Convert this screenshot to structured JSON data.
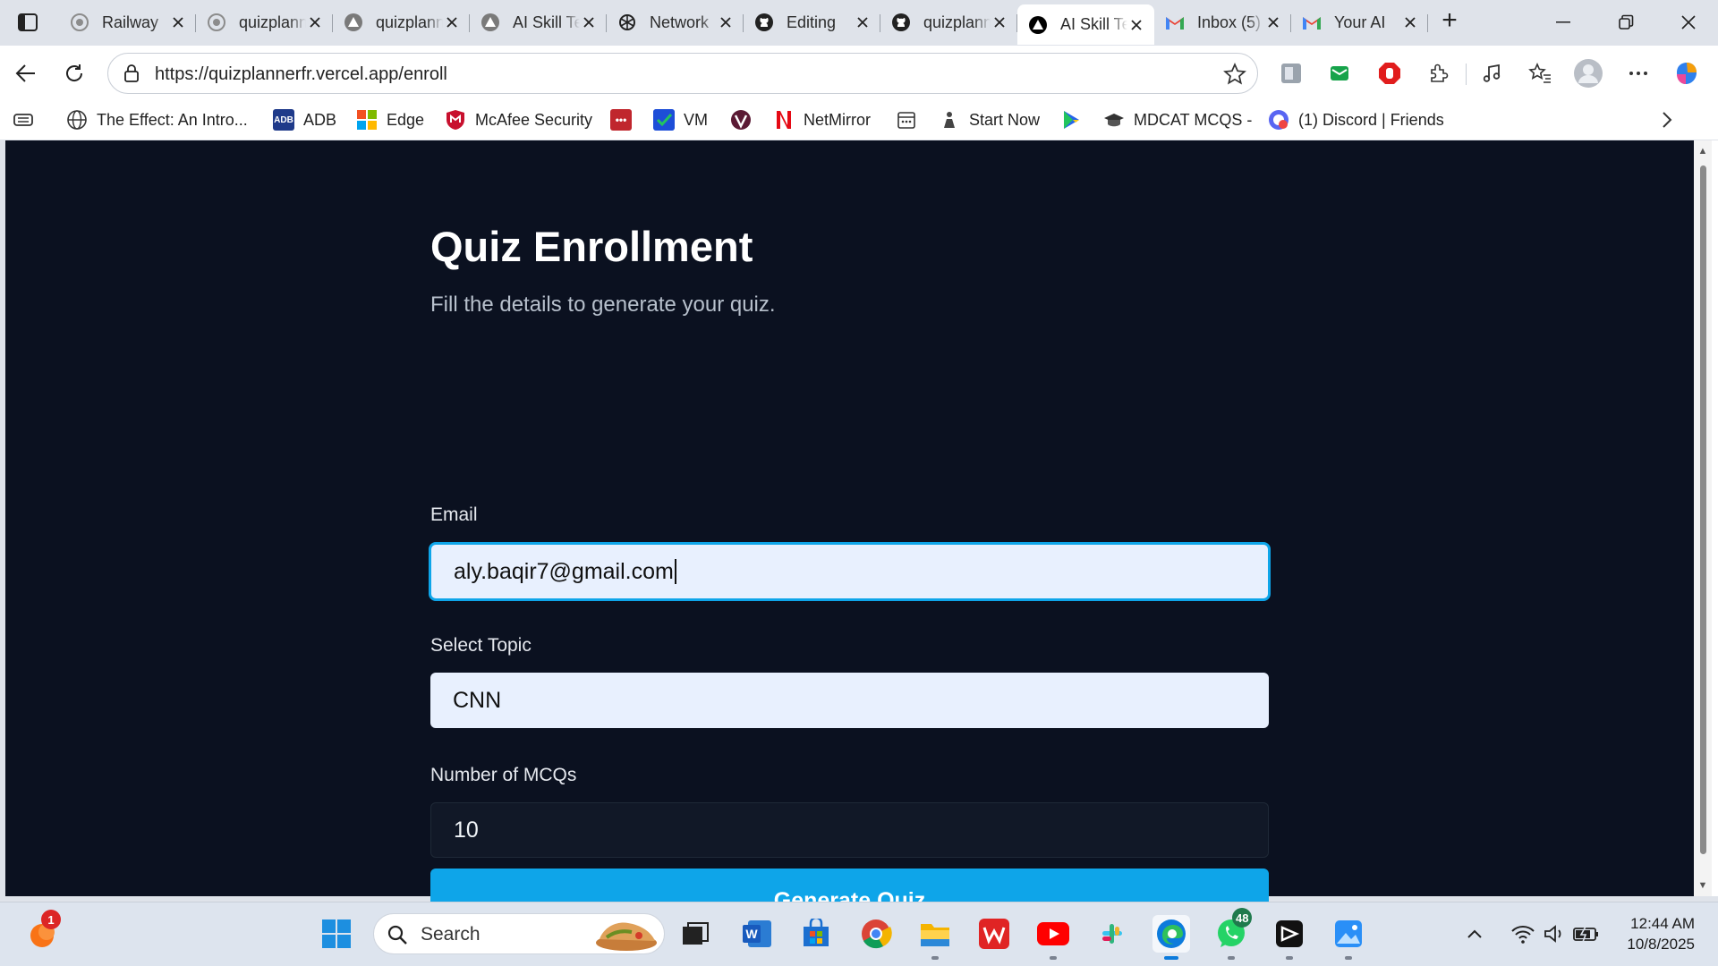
{
  "browser": {
    "tabs": [
      {
        "title": "Railway",
        "favicon": "globe-icon",
        "color": "#8c8c8c"
      },
      {
        "title": "quizplanner",
        "favicon": "globe-icon",
        "color": "#8c8c8c"
      },
      {
        "title": "quizplanner",
        "favicon": "triangle-icon",
        "color": "#7a7a7a"
      },
      {
        "title": "AI Skill Test",
        "favicon": "triangle-icon",
        "color": "#7a7a7a"
      },
      {
        "title": "Network",
        "favicon": "openai-icon",
        "color": "#222222"
      },
      {
        "title": "Editing",
        "favicon": "github-icon",
        "color": "#222222"
      },
      {
        "title": "quizplanner",
        "favicon": "github-icon",
        "color": "#222222"
      },
      {
        "title": "AI Skill Test",
        "favicon": "vercel-icon",
        "color": "#000000",
        "active": true
      },
      {
        "title": "Inbox (5)",
        "favicon": "gmail-icon",
        "color": "#ea4335"
      },
      {
        "title": "Your AI",
        "favicon": "gmail-icon",
        "color": "#ea4335"
      }
    ],
    "url": "https://quizplannerfr.vercel.app/enroll",
    "bookmarks": [
      {
        "label": "",
        "icon": "reading-list-icon"
      },
      {
        "label": "The Effect: An Intro...",
        "icon": "globe-icon"
      },
      {
        "label": "ADB",
        "icon": "adb-icon",
        "color": "#1f3a8a"
      },
      {
        "label": "Edge",
        "icon": "windows-logo-icon"
      },
      {
        "label": "McAfee Security",
        "icon": "mcafee-icon",
        "color": "#c8102e"
      },
      {
        "label": "",
        "icon": "dots-app-icon",
        "color": "#c0262d"
      },
      {
        "label": "VM",
        "icon": "checkmark-icon",
        "color": "#2563eb"
      },
      {
        "label": "",
        "icon": "v-logo-icon",
        "color": "#7c1d3f"
      },
      {
        "label": "NetMirror",
        "icon": "netmirror-icon",
        "color": "#e50914"
      },
      {
        "label": "",
        "icon": "calendar-icon"
      },
      {
        "label": "Start Now",
        "icon": "person-icon"
      },
      {
        "label": "",
        "icon": "play-store-icon"
      },
      {
        "label": "MDCAT MCQS -",
        "icon": "cap-icon"
      },
      {
        "label": "(1) Discord | Friends",
        "icon": "discord-icon",
        "color": "#5865f2"
      }
    ]
  },
  "page": {
    "title": "Quiz Enrollment",
    "subtitle": "Fill the details to generate your quiz.",
    "email_label": "Email",
    "email_value": "aly.baqir7@gmail.com",
    "topic_label": "Select Topic",
    "topic_value": "CNN",
    "mcq_label": "Number of MCQs",
    "mcq_value": "10",
    "submit_label": "Generate Quiz",
    "colors": {
      "background": "#0b1120",
      "accent": "#0ea5e9",
      "field": "#e8f0fe"
    }
  },
  "taskbar": {
    "search_placeholder": "Search",
    "weather_badge": "1",
    "whatsapp_badge": "48",
    "time": "12:44 AM",
    "date": "10/8/2025"
  }
}
